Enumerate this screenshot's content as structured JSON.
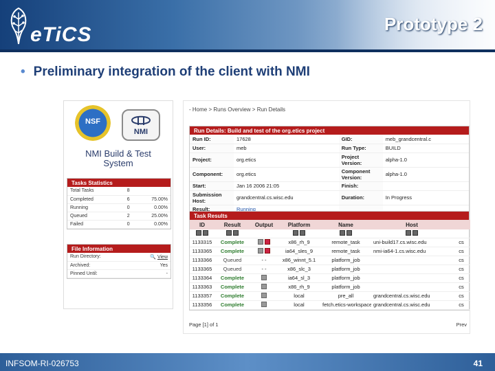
{
  "header": {
    "logo_text": "eTiCS",
    "title": "Prototype 2"
  },
  "bullet": "Preliminary integration of the client with NMI",
  "nmi": {
    "nsf_label": "NSF",
    "nmi_label": "NMI",
    "title_line1": "NMI Build & Test",
    "title_line2": "System",
    "tasks_stats": {
      "heading": "Tasks Statistics",
      "rows": [
        {
          "label": "Total Tasks",
          "count": "8",
          "pct": ""
        },
        {
          "label": "Completed",
          "count": "6",
          "pct": "75.00%"
        },
        {
          "label": "Running",
          "count": "0",
          "pct": "0.00%"
        },
        {
          "label": "Queued",
          "count": "2",
          "pct": "25.00%"
        },
        {
          "label": "Failed",
          "count": "0",
          "pct": "0.00%"
        }
      ]
    },
    "file_info": {
      "heading": "File Information",
      "rows": [
        {
          "label": "Run Directory:",
          "value": "View"
        },
        {
          "label": "Archived:",
          "value": "Yes"
        },
        {
          "label": "Pinned Until:",
          "value": "-"
        }
      ]
    }
  },
  "app": {
    "breadcrumb": "- Home > Runs Overview > Run Details",
    "run_details": {
      "heading": "Run Details:  Build and test of the org.etics project",
      "rows": [
        {
          "k1": "Run ID:",
          "v1": "17628",
          "k2": "GID:",
          "v2": "meb_grandcentral.c"
        },
        {
          "k1": "User:",
          "v1": "meb",
          "k2": "Run Type:",
          "v2": "BUILD"
        },
        {
          "k1": "Project:",
          "v1": "org.etics",
          "k2": "Project Version:",
          "v2": "alpha-1.0"
        },
        {
          "k1": "Component:",
          "v1": "org.etics",
          "k2": "Component Version:",
          "v2": "alpha-1.0"
        },
        {
          "k1": "Start:",
          "v1": "Jan 16 2006 21:05",
          "k2": "Finish:",
          "v2": ""
        },
        {
          "k1": "Submission Host:",
          "v1": "grandcentral.cs.wisc.edu",
          "k2": "Duration:",
          "v2": "In Progress"
        },
        {
          "k1": "Result:",
          "v1": "Running",
          "k2": "",
          "v2": ""
        }
      ]
    },
    "task_results": {
      "heading": "Task Results",
      "columns": [
        "ID",
        "Result",
        "Output",
        "Platform",
        "Name",
        "Host"
      ],
      "rows": [
        {
          "id": "1133315",
          "result": "Complete",
          "platform": "x86_rh_9",
          "name": "remote_task",
          "host": "uni-build17.cs.wisc.edu",
          "cut": "cs"
        },
        {
          "id": "1133365",
          "result": "Complete",
          "platform": "ia64_sles_9",
          "name": "remote_task",
          "host": "nmi-ia64-1.cs.wisc.edu",
          "cut": "cs"
        },
        {
          "id": "1133366",
          "result": "Queued",
          "platform": "x86_winnt_5.1",
          "name": "platform_job",
          "host": "",
          "cut": "cs"
        },
        {
          "id": "1133365",
          "result": "Queued",
          "platform": "x86_slc_3",
          "name": "platform_job",
          "host": "",
          "cut": "cs"
        },
        {
          "id": "1133364",
          "result": "Complete",
          "platform": "ia64_sl_3",
          "name": "platform_job",
          "host": "",
          "cut": "cs"
        },
        {
          "id": "1133363",
          "result": "Complete",
          "platform": "x86_rh_9",
          "name": "platform_job",
          "host": "",
          "cut": "cs"
        },
        {
          "id": "1133357",
          "result": "Complete",
          "platform": "local",
          "name": "pre_all",
          "host": "grandcentral.cs.wisc.edu",
          "cut": "cs"
        },
        {
          "id": "1133356",
          "result": "Complete",
          "platform": "local",
          "name": "fetch.etics-workspace-...",
          "host": "grandcentral.cs.wisc.edu",
          "cut": "cs"
        }
      ],
      "paging": "Page [1] of 1",
      "prev": "Prev"
    }
  },
  "footer": {
    "left": "INFSOM-RI-026753",
    "right": "41"
  }
}
